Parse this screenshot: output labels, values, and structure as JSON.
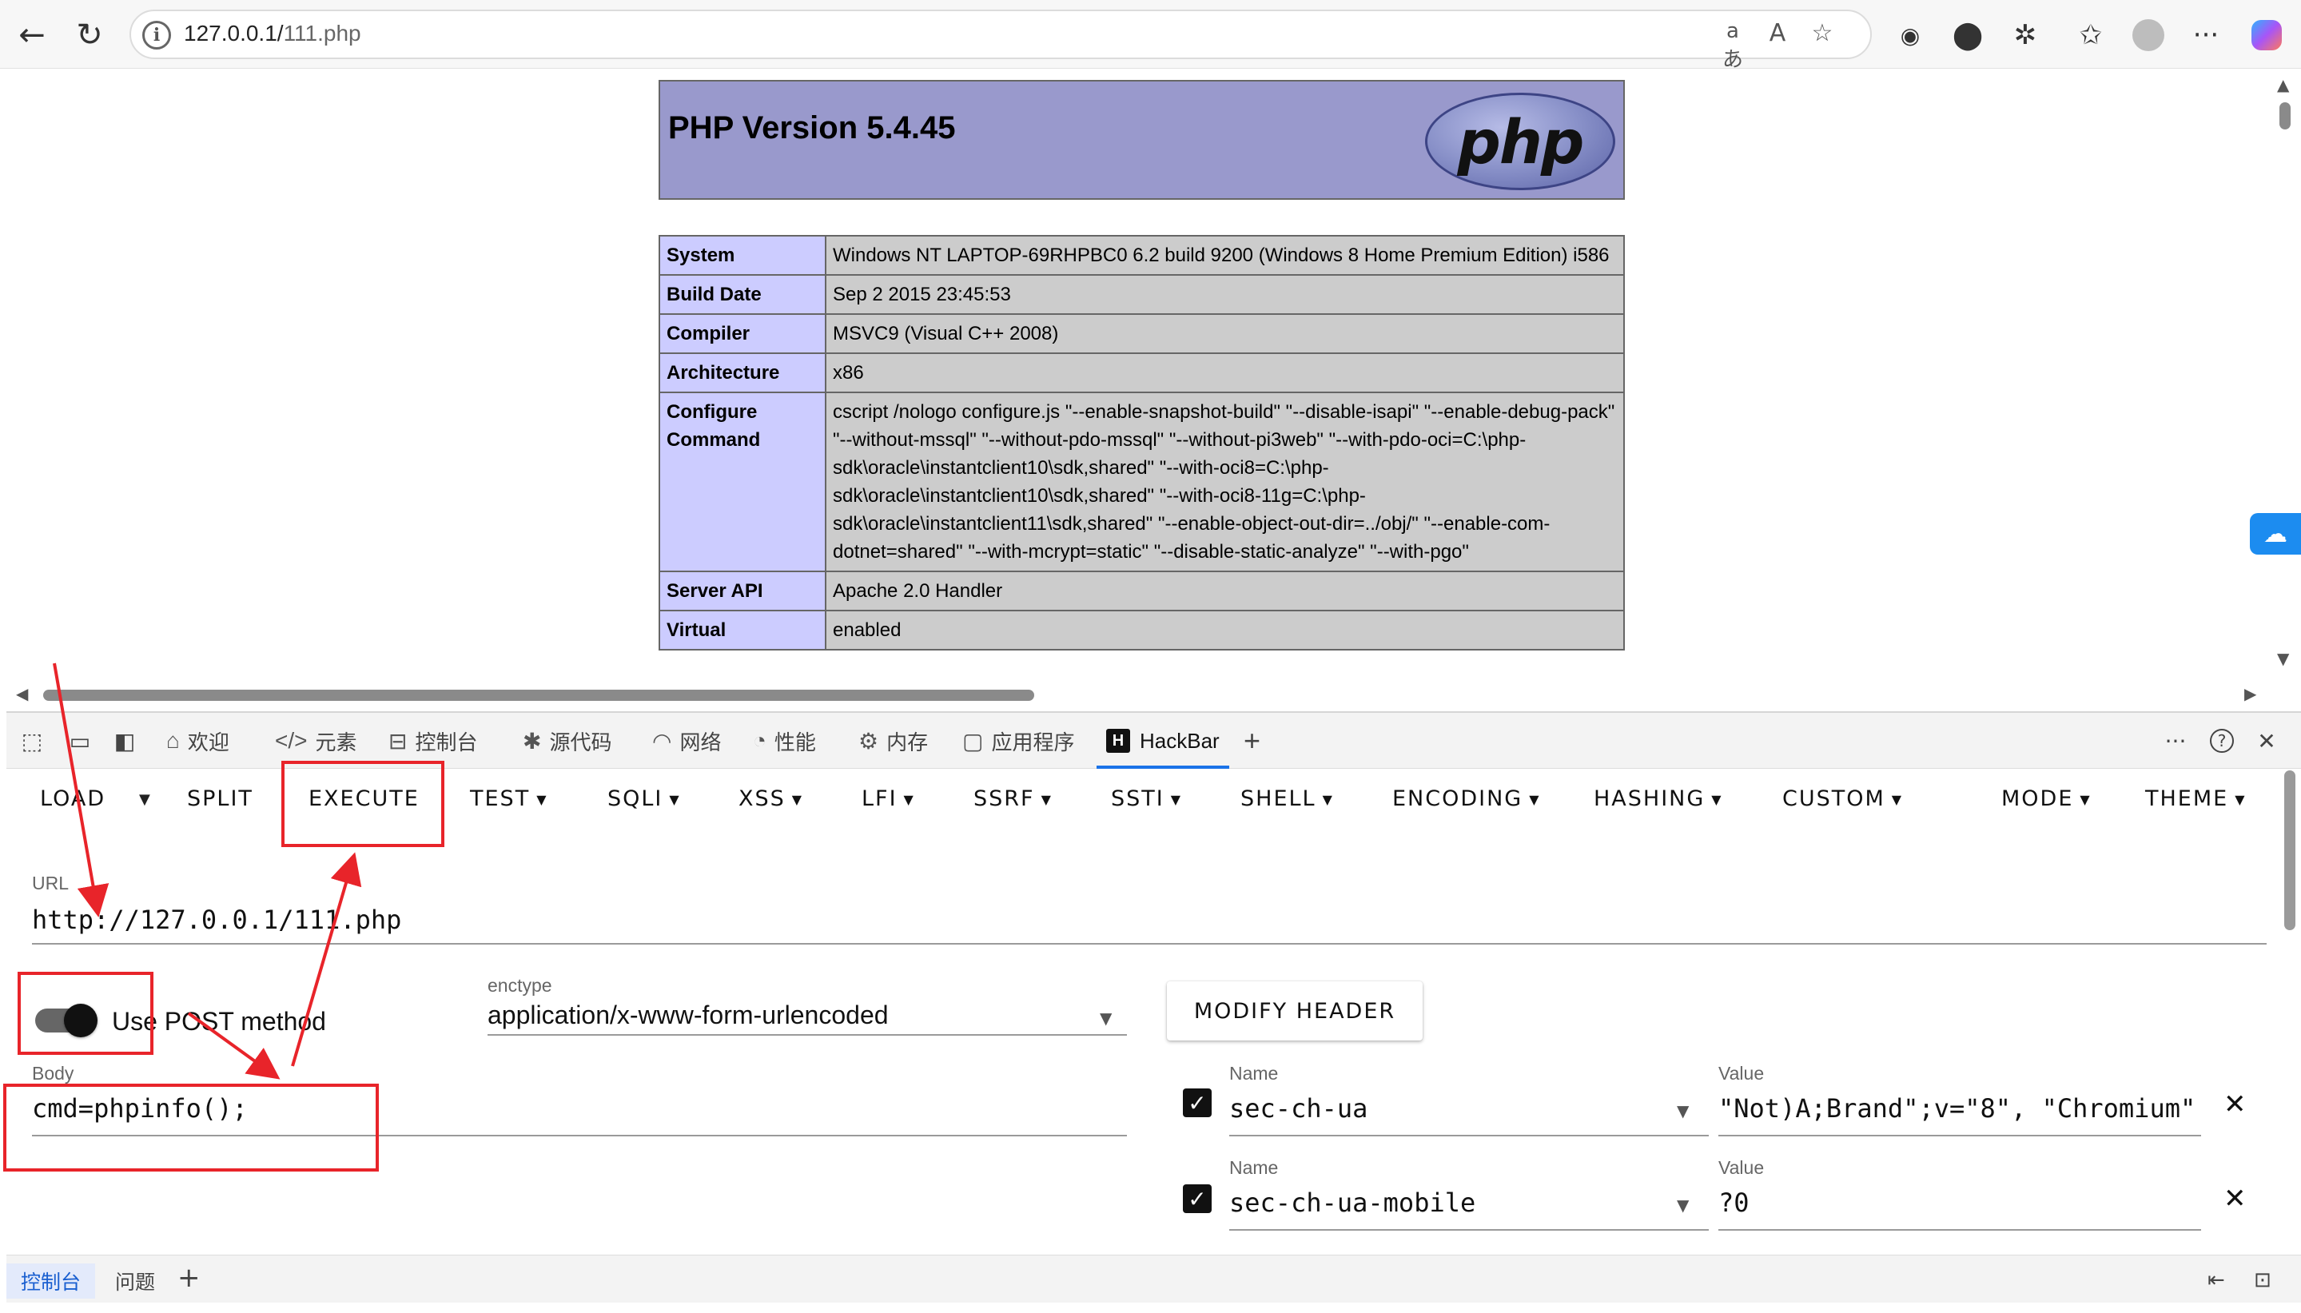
{
  "browser": {
    "back_icon": "arrow-left-icon",
    "refresh_icon": "refresh-icon",
    "url_host": "127.0.0.1/",
    "url_path": "111.php",
    "read_aloud_glyph": "aあ",
    "read_glyph": "A",
    "more_glyph": "···"
  },
  "php": {
    "version_title": "PHP Version 5.4.45",
    "logo_text": "php",
    "rows": [
      {
        "key": "System",
        "value": "Windows NT LAPTOP-69RHPBC0 6.2 build 9200 (Windows 8 Home Premium Edition) i586"
      },
      {
        "key": "Build Date",
        "value": "Sep 2 2015 23:45:53"
      },
      {
        "key": "Compiler",
        "value": "MSVC9 (Visual C++ 2008)"
      },
      {
        "key": "Architecture",
        "value": "x86"
      },
      {
        "key": "Configure Command",
        "value": "cscript /nologo configure.js \"--enable-snapshot-build\" \"--disable-isapi\" \"--enable-debug-pack\" \"--without-mssql\" \"--without-pdo-mssql\" \"--without-pi3web\" \"--with-pdo-oci=C:\\php-sdk\\oracle\\instantclient10\\sdk,shared\" \"--with-oci8=C:\\php-sdk\\oracle\\instantclient10\\sdk,shared\" \"--with-oci8-11g=C:\\php-sdk\\oracle\\instantclient11\\sdk,shared\" \"--enable-object-out-dir=../obj/\" \"--enable-com-dotnet=shared\" \"--with-mcrypt=static\" \"--disable-static-analyze\" \"--with-pgo\""
      },
      {
        "key": "Server API",
        "value": "Apache 2.0 Handler"
      },
      {
        "key": "Virtual",
        "value": "enabled"
      }
    ]
  },
  "devtools": {
    "tabs": [
      {
        "label": "欢迎"
      },
      {
        "label": "元素"
      },
      {
        "label": "控制台"
      },
      {
        "label": "源代码"
      },
      {
        "label": "网络"
      },
      {
        "label": "性能"
      },
      {
        "label": "内存"
      },
      {
        "label": "应用程序"
      },
      {
        "label": "HackBar"
      }
    ],
    "hackbar_badge": "H",
    "add_tab": "+",
    "more": "···",
    "help": "?",
    "close": "✕",
    "drawer": {
      "console": "控制台",
      "issues": "问题",
      "add": "+"
    }
  },
  "hackbar": {
    "menu": {
      "load": "LOAD",
      "split": "SPLIT",
      "execute": "EXECUTE",
      "test": "TEST",
      "sqli": "SQLI",
      "xss": "XSS",
      "lfi": "LFI",
      "ssrf": "SSRF",
      "ssti": "SSTI",
      "shell": "SHELL",
      "encoding": "ENCODING",
      "hashing": "HASHING",
      "custom": "CUSTOM",
      "mode": "MODE",
      "theme": "THEME"
    },
    "url_label": "URL",
    "url_value": "http://127.0.0.1/111.php",
    "post_toggle_label": "Use POST method",
    "post_enabled": true,
    "enctype_label": "enctype",
    "enctype_value": "application/x-www-form-urlencoded",
    "body_label": "Body",
    "body_value": "cmd=phpinfo();",
    "modify_header": "MODIFY HEADER",
    "headers": [
      {
        "name_label": "Name",
        "name": "sec-ch-ua",
        "value_label": "Value",
        "value": "\"Not)A;Brand\";v=\"8\", \"Chromium\"",
        "checked": true
      },
      {
        "name_label": "Name",
        "name": "sec-ch-ua-mobile",
        "value_label": "Value",
        "value": "?0",
        "checked": true
      }
    ]
  },
  "colors": {
    "annotation_red": "#e8242a",
    "php_header": "#9999cc",
    "php_key": "#ccccff",
    "php_value": "#cccccc",
    "accent_blue": "#1a73e8"
  }
}
